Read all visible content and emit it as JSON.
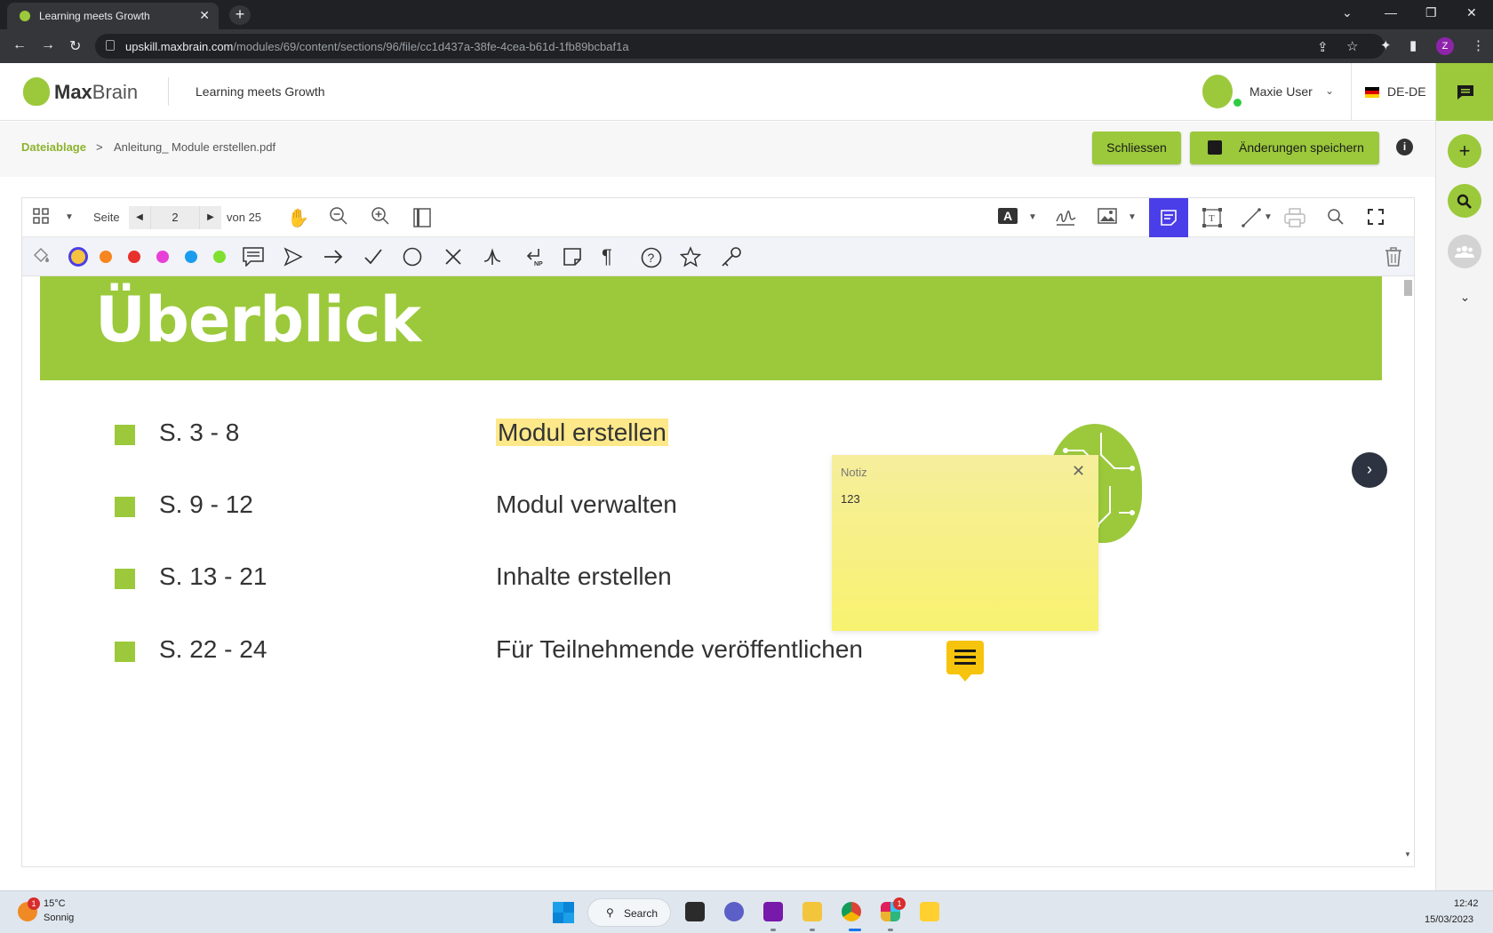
{
  "browser": {
    "tab_title": "Learning meets Growth",
    "tab_close": "✕",
    "new_tab": "+",
    "url_host": "upskill.maxbrain.com",
    "url_path": "/modules/69/content/sections/96/file/cc1d437a-38fe-4cea-b61d-1fb89bcbaf1a",
    "profile_initial": "Z"
  },
  "app_header": {
    "logo_bold": "Max",
    "logo_light": "Brain",
    "title": "Learning meets Growth",
    "user_name": "Maxie User",
    "language": "DE-DE"
  },
  "breadcrumb": {
    "root": "Dateiablage",
    "separator": ">",
    "file": "Anleitung_ Module erstellen.pdf"
  },
  "actions": {
    "close_label": "Schliessen",
    "save_label": "Änderungen speichern",
    "info_glyph": "i"
  },
  "viewer": {
    "page_label": "Seite",
    "current_page": "2",
    "total_label": "von 25",
    "annotation_colors": [
      "#f6c33f",
      "#f6861f",
      "#e8302c",
      "#e83fd8",
      "#1b9cf0",
      "#7fe030"
    ],
    "active_tool": "sticky-note",
    "document": {
      "heading": "Überblick",
      "rows": [
        {
          "pages": "S. 3 - 8",
          "topic": "Modul erstellen"
        },
        {
          "pages": "S. 9 - 12",
          "topic": "Modul verwalten"
        },
        {
          "pages": "S. 13 - 21",
          "topic": "Inhalte erstellen"
        },
        {
          "pages": "S. 22 - 24",
          "topic": "Für Teilnehmende veröffentlichen"
        }
      ]
    },
    "note": {
      "title": "Notiz",
      "text": "123"
    }
  },
  "taskbar": {
    "weather_temp": "15°C",
    "weather_desc": "Sonnig",
    "weather_badge": "1",
    "search_label": "Search",
    "slack_badge": "1",
    "time": "12:42",
    "date": "15/03/2023"
  },
  "colors": {
    "brand_green": "#9bc93b",
    "active_tool_blue": "#4a3ee8",
    "note_yellow": "#f8f270"
  }
}
